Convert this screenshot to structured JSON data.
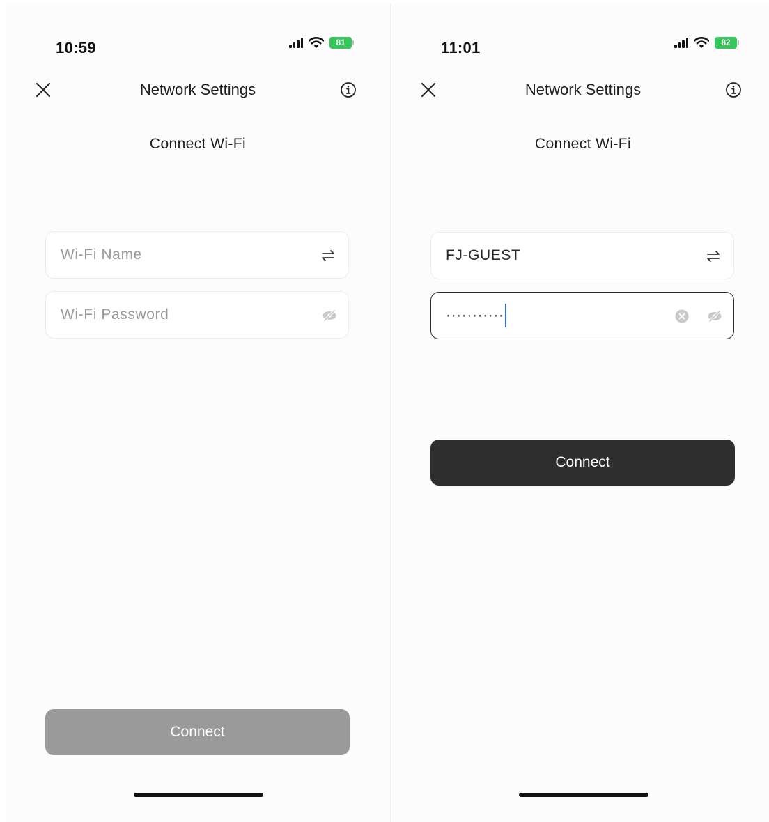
{
  "screens": [
    {
      "status": {
        "time": "10:59",
        "battery": "81"
      },
      "header": {
        "title": "Network Settings",
        "close_icon": "close-icon",
        "info_icon": "info-icon"
      },
      "subtitle": "Connect Wi-Fi",
      "wifi_name": {
        "placeholder": "Wi-Fi Name",
        "value": ""
      },
      "wifi_password": {
        "placeholder": "Wi-Fi Password",
        "value": ""
      },
      "connect_button": {
        "label": "Connect",
        "state": "disabled",
        "color": "#9a9a9a"
      }
    },
    {
      "status": {
        "time": "11:01",
        "battery": "82"
      },
      "header": {
        "title": "Network Settings",
        "close_icon": "close-icon",
        "info_icon": "info-icon"
      },
      "subtitle": "Connect Wi-Fi",
      "wifi_name": {
        "placeholder": "Wi-Fi Name",
        "value": "FJ-GUEST"
      },
      "wifi_password": {
        "placeholder": "Wi-Fi Password",
        "value": "···········",
        "focused": true
      },
      "connect_button": {
        "label": "Connect",
        "state": "enabled",
        "color": "#2e2e2e"
      }
    }
  ],
  "colors": {
    "battery": "#34c759",
    "caret": "#2f6fe4"
  }
}
